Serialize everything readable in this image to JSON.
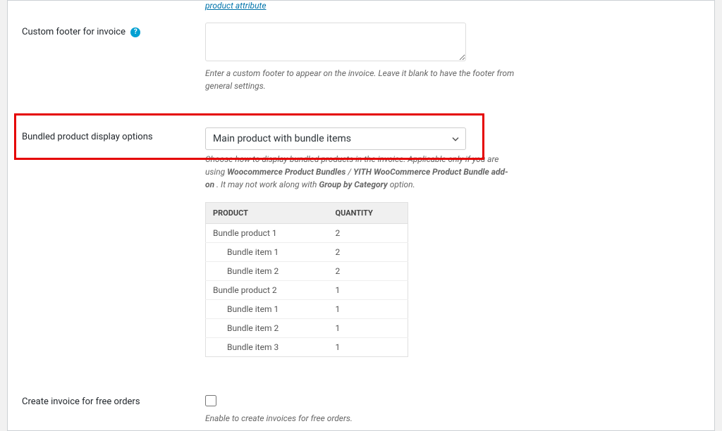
{
  "hint_link": "product attribute",
  "footer": {
    "label": "Custom footer for invoice",
    "value": "",
    "description": "Enter a custom footer to appear on the invoice. Leave it blank to have the footer from general settings."
  },
  "bundle": {
    "label": "Bundled product display options",
    "selected": "Main product with bundle items",
    "description_line1": "Choose how to display bundled products in the invoice. Applicable only if you are using ",
    "description_bold1": "Woocommerce Product Bundles",
    "description_sep": " / ",
    "description_bold2": "YITH WooCommerce Product Bundle add-on",
    "description_line2": " . It may not work along with ",
    "description_bold3": "Group by Category",
    "description_line3": " option.",
    "table": {
      "headers": {
        "product": "PRODUCT",
        "quantity": "QUANTITY"
      },
      "rows": [
        {
          "product": "Bundle product 1",
          "quantity": "2",
          "indent": false
        },
        {
          "product": "Bundle item 1",
          "quantity": "2",
          "indent": true
        },
        {
          "product": "Bundle item 2",
          "quantity": "2",
          "indent": true
        },
        {
          "product": "Bundle product 2",
          "quantity": "1",
          "indent": false
        },
        {
          "product": "Bundle item 1",
          "quantity": "1",
          "indent": true
        },
        {
          "product": "Bundle item 2",
          "quantity": "1",
          "indent": true
        },
        {
          "product": "Bundle item 3",
          "quantity": "1",
          "indent": true
        }
      ]
    }
  },
  "free_orders": {
    "label": "Create invoice for free orders",
    "checked": false,
    "description": "Enable to create invoices for free orders."
  }
}
